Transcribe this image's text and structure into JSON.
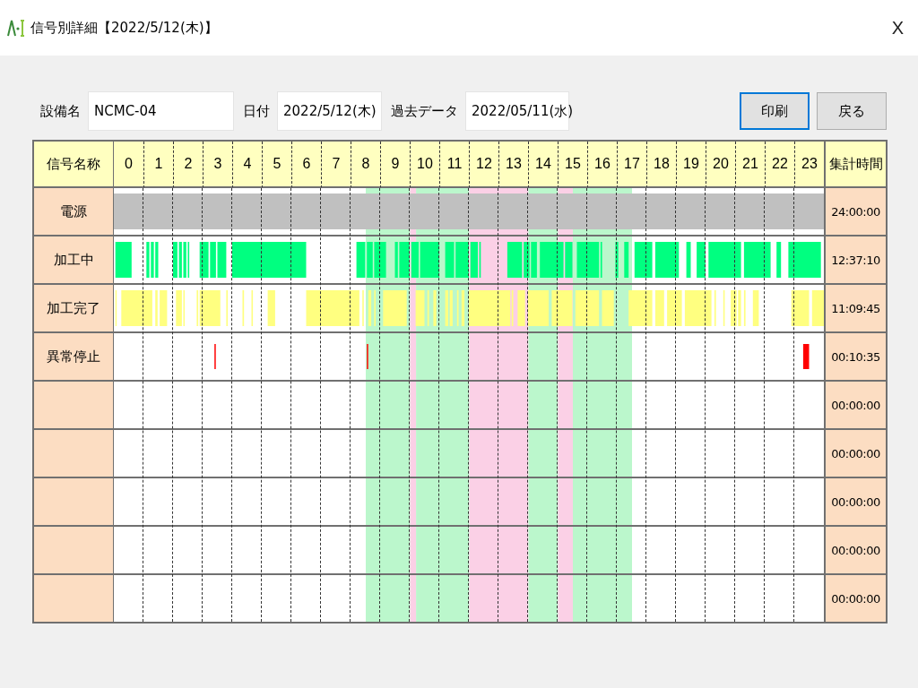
{
  "window": {
    "title": "信号別詳細【2022/5/12(木)】",
    "close": "X"
  },
  "form": {
    "fields": [
      {
        "label": "設備名",
        "value": "NCMC-04"
      },
      {
        "label": "日付",
        "value": "2022/5/12(木)"
      },
      {
        "label": "過去データ",
        "value": "2022/05/11(水)"
      }
    ]
  },
  "buttons": [
    {
      "label": "印刷",
      "focused": true
    },
    {
      "label": "戻る",
      "focused": false
    }
  ],
  "table": {
    "columns": {
      "name": "信号名称",
      "hours": [
        "0",
        "1",
        "2",
        "3",
        "4",
        "5",
        "6",
        "7",
        "8",
        "9",
        "10",
        "11",
        "12",
        "13",
        "14",
        "15",
        "16",
        "17",
        "18",
        "19",
        "20",
        "21",
        "22",
        "23"
      ],
      "total": "集計時間"
    },
    "rows": [
      {
        "name": "電源",
        "total": "24:00:00",
        "color": "#c0c0c0"
      },
      {
        "name": "加工中",
        "total": "12:37:10",
        "color": "#00ff80"
      },
      {
        "name": "加工完了",
        "total": "11:09:45",
        "color": "#ffff80"
      },
      {
        "name": "異常停止",
        "total": "00:10:35",
        "color": "#ff0000"
      },
      {
        "total": "00:00:00"
      },
      {
        "total": "00:00:00"
      },
      {
        "total": "00:00:00"
      },
      {
        "total": "00:00:00"
      },
      {
        "total": "00:00:00"
      }
    ]
  }
}
